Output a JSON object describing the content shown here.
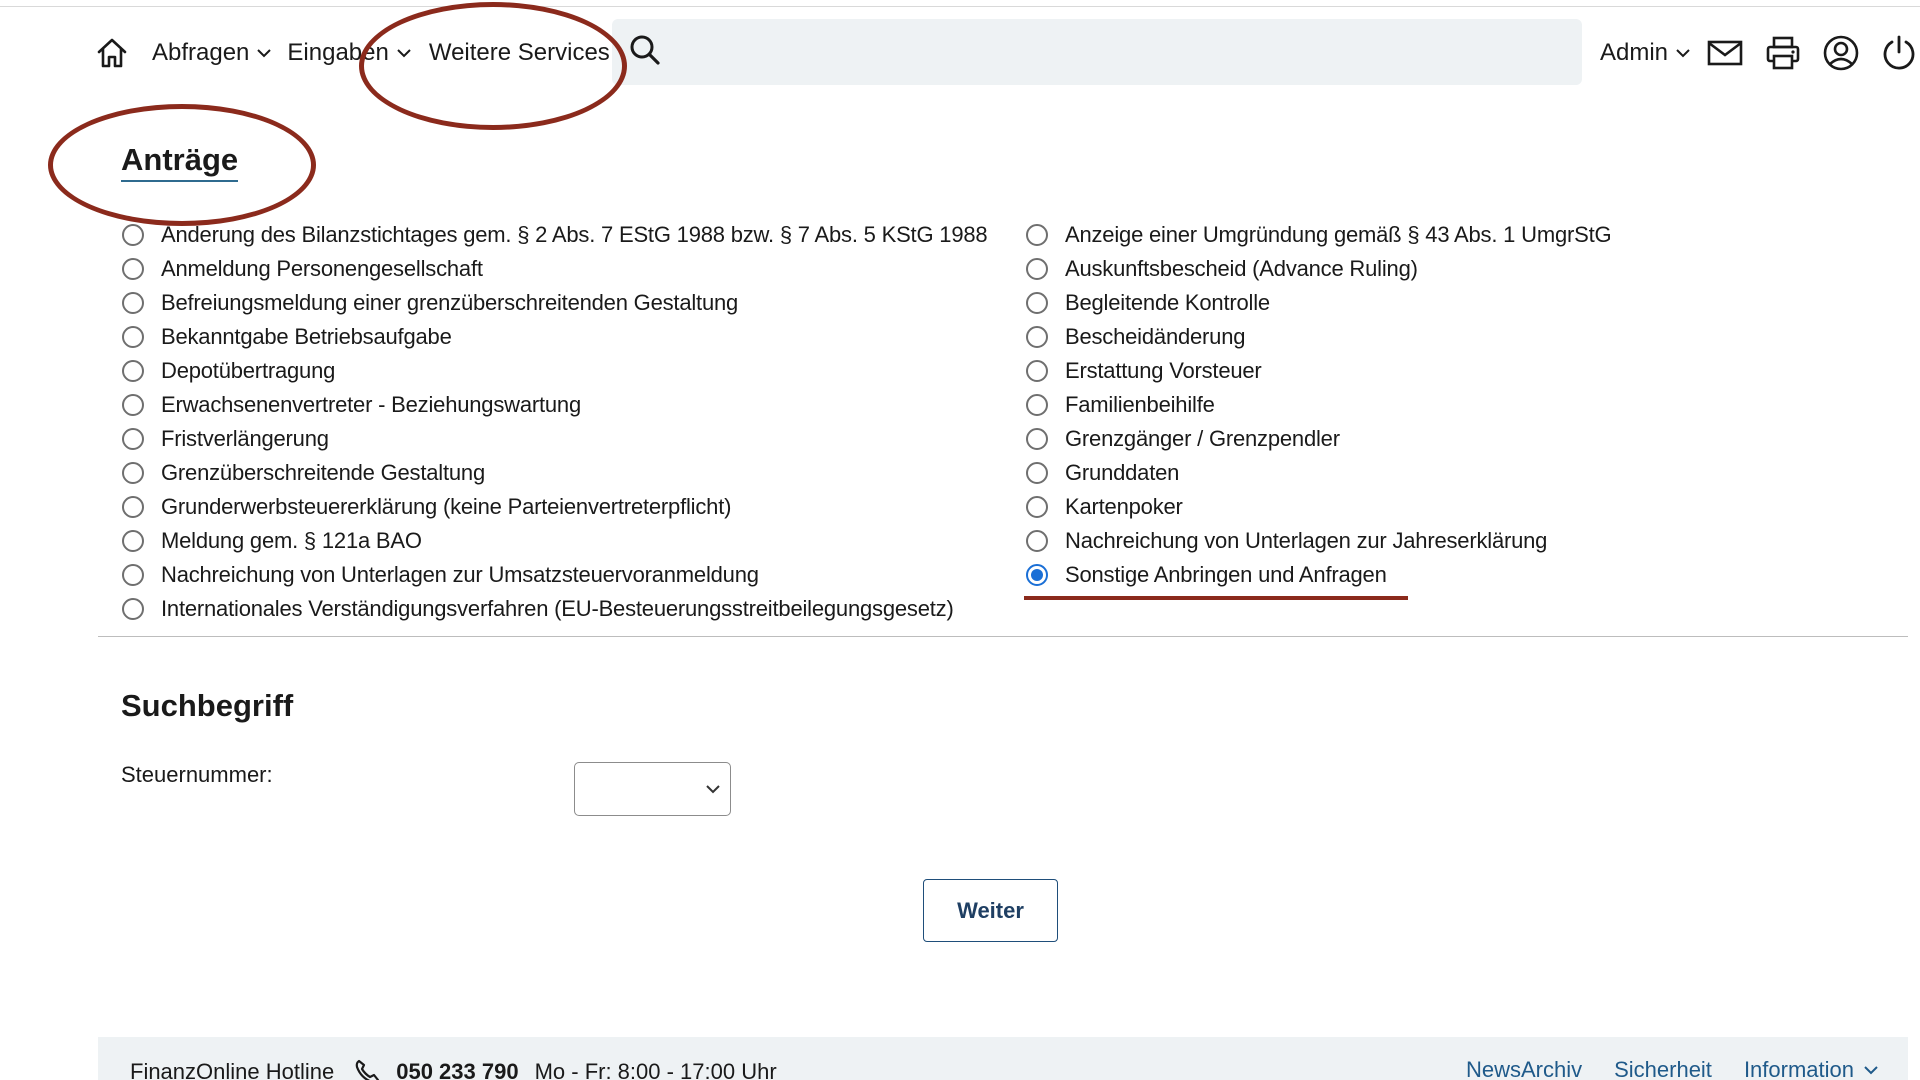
{
  "header": {
    "home_icon": "home-icon",
    "nav": [
      {
        "label": "Abfragen",
        "has_dropdown": true
      },
      {
        "label": "Eingaben",
        "has_dropdown": true
      },
      {
        "label": "Weitere Services",
        "has_dropdown": false
      }
    ],
    "search": {
      "icon": "search-icon",
      "value": ""
    },
    "user": {
      "label": "Admin",
      "has_dropdown": true
    },
    "tools": [
      "mail-icon",
      "printer-icon",
      "user-account-icon",
      "power-icon"
    ]
  },
  "antraege": {
    "title": "Anträge",
    "left": [
      {
        "label": "Änderung des Bilanzstichtages gem. § 2 Abs. 7 EStG 1988 bzw. § 7 Abs. 5 KStG 1988",
        "checked": false
      },
      {
        "label": "Anmeldung Personengesellschaft",
        "checked": false
      },
      {
        "label": "Befreiungsmeldung einer grenzüberschreitenden Gestaltung",
        "checked": false
      },
      {
        "label": "Bekanntgabe Betriebsaufgabe",
        "checked": false
      },
      {
        "label": "Depotübertragung",
        "checked": false
      },
      {
        "label": "Erwachsenenvertreter - Beziehungswartung",
        "checked": false
      },
      {
        "label": "Fristverlängerung",
        "checked": false
      },
      {
        "label": "Grenzüberschreitende Gestaltung",
        "checked": false
      },
      {
        "label": "Grunderwerbsteuererklärung (keine Parteienvertreterpflicht)",
        "checked": false
      },
      {
        "label": "Meldung gem. § 121a BAO",
        "checked": false
      },
      {
        "label": "Nachreichung von Unterlagen zur Umsatzsteuervoranmeldung",
        "checked": false
      },
      {
        "label": "Internationales Verständigungsverfahren (EU-Besteuerungsstreitbeilegungsgesetz)",
        "checked": false
      }
    ],
    "right": [
      {
        "label": "Anzeige einer Umgründung gemäß § 43 Abs. 1 UmgrStG",
        "checked": false
      },
      {
        "label": "Auskunftsbescheid (Advance Ruling)",
        "checked": false
      },
      {
        "label": "Begleitende Kontrolle",
        "checked": false
      },
      {
        "label": "Bescheidänderung",
        "checked": false
      },
      {
        "label": "Erstattung Vorsteuer",
        "checked": false
      },
      {
        "label": "Familienbeihilfe",
        "checked": false
      },
      {
        "label": "Grenzgänger / Grenzpendler",
        "checked": false
      },
      {
        "label": "Grunddaten",
        "checked": false
      },
      {
        "label": "Kartenpoker",
        "checked": false
      },
      {
        "label": "Nachreichung von Unterlagen zur Jahreserklärung",
        "checked": false
      },
      {
        "label": "Sonstige Anbringen und Anfragen",
        "checked": true
      }
    ]
  },
  "suchbegriff": {
    "title": "Suchbegriff",
    "field_label": "Steuernummer:",
    "select_value": ""
  },
  "actions": {
    "next_label": "Weiter"
  },
  "footer": {
    "hotline_label": "FinanzOnline Hotline",
    "phone_icon": "phone-icon",
    "phone_number": "050 233 790",
    "hours": "Mo - Fr: 8:00 - 17:00 Uhr",
    "links": [
      {
        "label": "NewsArchiv",
        "has_dropdown": false
      },
      {
        "label": "Sicherheit",
        "has_dropdown": false
      },
      {
        "label": "Information",
        "has_dropdown": true
      }
    ]
  },
  "colors": {
    "annotation": "#8b2a1c",
    "radio_selected": "#1a6fd6",
    "link": "#1f5a8a",
    "button_border": "#1f4e7a",
    "search_bg": "#eef2f4"
  }
}
